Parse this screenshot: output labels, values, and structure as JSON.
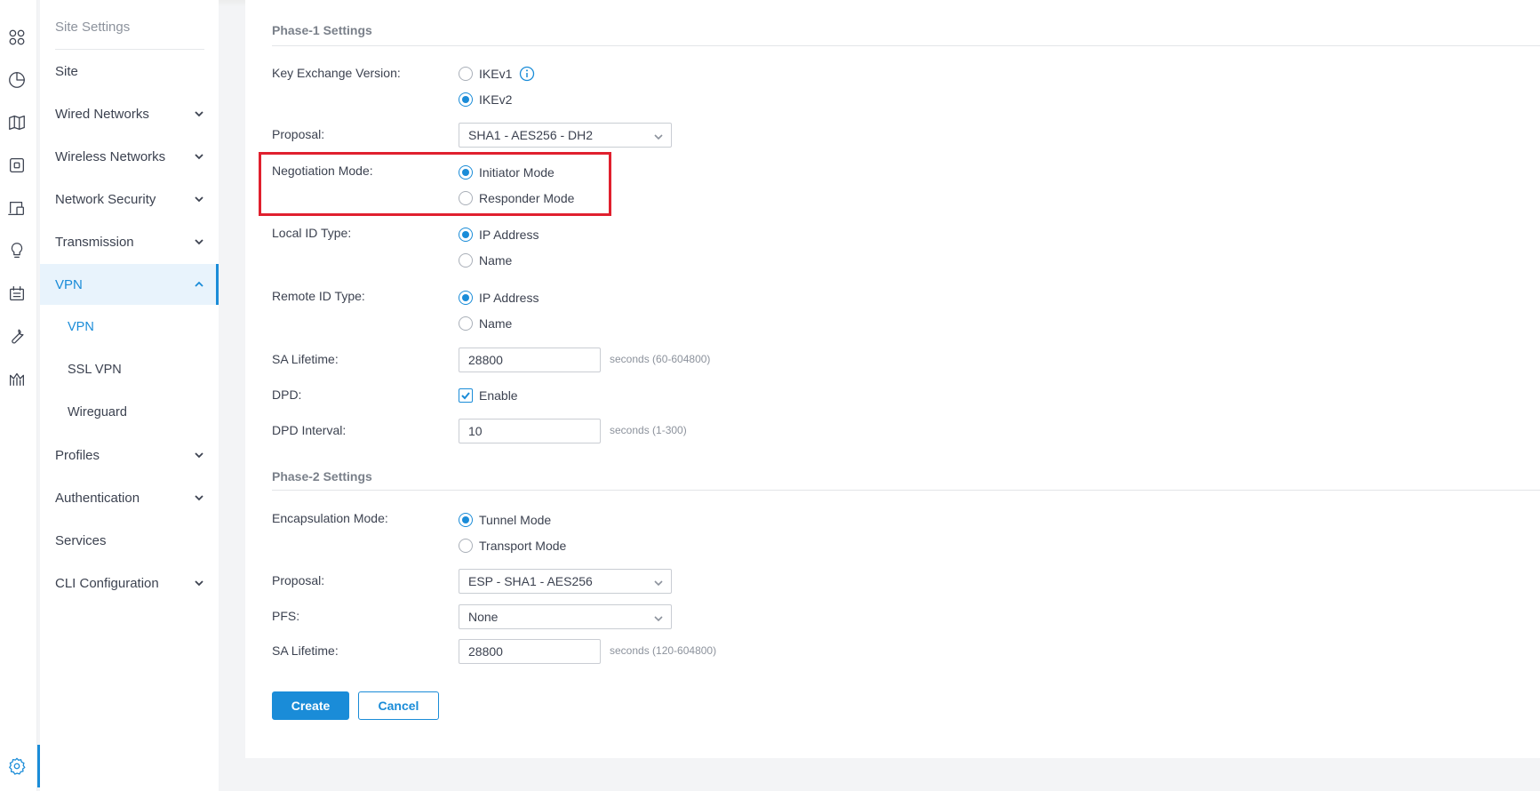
{
  "colors": {
    "accent": "#1a8cd8",
    "highlight": "#e0202e"
  },
  "rail": {
    "icons": [
      "dashboard-icon",
      "statistics-icon",
      "map-icon",
      "devices-icon",
      "clients-icon",
      "insights-icon",
      "logs-icon",
      "tools-icon",
      "reports-icon",
      "settings-icon"
    ]
  },
  "nav": {
    "heading": "Site Settings",
    "items": [
      {
        "label": "Site"
      },
      {
        "label": "Wired Networks"
      },
      {
        "label": "Wireless Networks"
      },
      {
        "label": "Network Security"
      },
      {
        "label": "Transmission"
      },
      {
        "label": "VPN"
      },
      {
        "label": "VPN"
      },
      {
        "label": "SSL VPN"
      },
      {
        "label": "Wireguard"
      },
      {
        "label": "Profiles"
      },
      {
        "label": "Authentication"
      },
      {
        "label": "Services"
      },
      {
        "label": "CLI Configuration"
      }
    ]
  },
  "phase1": {
    "title": "Phase-1 Settings",
    "key_exchange": {
      "label": "Key Exchange Version:",
      "options": [
        "IKEv1",
        "IKEv2"
      ],
      "selected": "IKEv2"
    },
    "proposal": {
      "label": "Proposal:",
      "value": "SHA1 - AES256 - DH2"
    },
    "negotiation": {
      "label": "Negotiation Mode:",
      "options": [
        "Initiator Mode",
        "Responder Mode"
      ],
      "selected": "Initiator Mode"
    },
    "local_id": {
      "label": "Local ID Type:",
      "options": [
        "IP Address",
        "Name"
      ],
      "selected": "IP Address"
    },
    "remote_id": {
      "label": "Remote ID Type:",
      "options": [
        "IP Address",
        "Name"
      ],
      "selected": "IP Address"
    },
    "sa_lifetime": {
      "label": "SA Lifetime:",
      "value": "28800",
      "hint": "seconds (60-604800)"
    },
    "dpd": {
      "label": "DPD:",
      "checkbox_label": "Enable",
      "checked": true
    },
    "dpd_interval": {
      "label": "DPD Interval:",
      "value": "10",
      "hint": "seconds (1-300)"
    }
  },
  "phase2": {
    "title": "Phase-2 Settings",
    "encapsulation": {
      "label": "Encapsulation Mode:",
      "options": [
        "Tunnel Mode",
        "Transport Mode"
      ],
      "selected": "Tunnel Mode"
    },
    "proposal": {
      "label": "Proposal:",
      "value": "ESP - SHA1 - AES256"
    },
    "pfs": {
      "label": "PFS:",
      "value": "None"
    },
    "sa_lifetime": {
      "label": "SA Lifetime:",
      "value": "28800",
      "hint": "seconds (120-604800)"
    }
  },
  "actions": {
    "create": "Create",
    "cancel": "Cancel"
  }
}
